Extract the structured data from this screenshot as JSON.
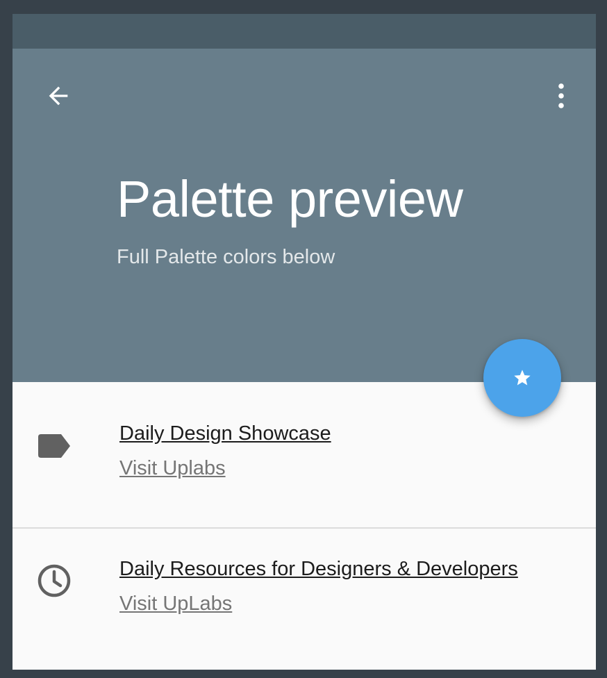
{
  "header": {
    "title": "Palette preview",
    "subtitle": "Full Palette colors below",
    "back_icon": "arrow-back-icon",
    "menu_icon": "more-vert-icon"
  },
  "fab": {
    "icon": "star-icon"
  },
  "list": {
    "items": [
      {
        "icon": "label-icon",
        "title": "Daily Design Showcase",
        "link": "Visit Uplabs"
      },
      {
        "icon": "clock-icon",
        "title": "Daily Resources for Designers & Developers",
        "link": "Visit UpLabs"
      }
    ]
  },
  "colors": {
    "page_background": "#37414a",
    "status_bar": "#4a5d68",
    "header": "#687e8b",
    "fab": "#4ca3ea",
    "surface": "#fafafa",
    "icon": "#616161"
  }
}
